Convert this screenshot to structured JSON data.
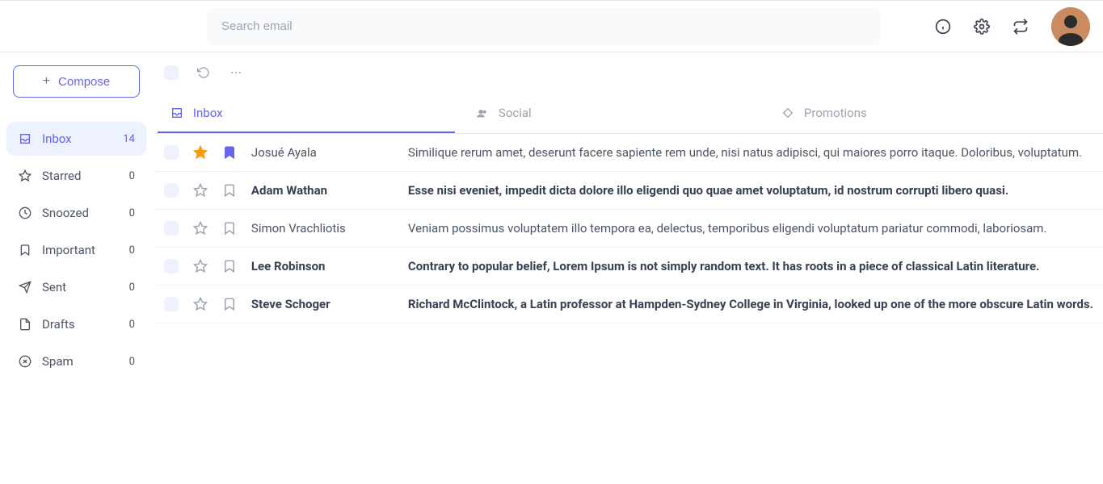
{
  "search": {
    "placeholder": "Search email"
  },
  "compose_label": "Compose",
  "sidebar": {
    "items": [
      {
        "label": "Inbox",
        "count": "14",
        "icon": "inbox",
        "active": true
      },
      {
        "label": "Starred",
        "count": "0",
        "icon": "star"
      },
      {
        "label": "Snoozed",
        "count": "0",
        "icon": "clock"
      },
      {
        "label": "Important",
        "count": "0",
        "icon": "bookmark"
      },
      {
        "label": "Sent",
        "count": "0",
        "icon": "send"
      },
      {
        "label": "Drafts",
        "count": "0",
        "icon": "file"
      },
      {
        "label": "Spam",
        "count": "0",
        "icon": "x-circle"
      }
    ]
  },
  "tabs": [
    {
      "label": "Inbox",
      "active": true
    },
    {
      "label": "Social"
    },
    {
      "label": "Promotions"
    }
  ],
  "emails": [
    {
      "sender": "Josué Ayala",
      "subject": "Similique rerum amet, deserunt facere sapiente rem unde, nisi natus adipisci, qui maiores porro itaque. Doloribus, voluptatum.",
      "unread": false,
      "starred": true,
      "bookmarked": true
    },
    {
      "sender": "Adam Wathan",
      "subject": "Esse nisi eveniet, impedit dicta dolore illo eligendi quo quae amet voluptatum, id nostrum corrupti libero quasi.",
      "unread": true,
      "starred": false,
      "bookmarked": false
    },
    {
      "sender": "Simon Vrachliotis",
      "subject": "Veniam possimus voluptatem illo tempora ea, delectus, temporibus eligendi voluptatum pariatur commodi, laboriosam.",
      "unread": false,
      "starred": false,
      "bookmarked": false
    },
    {
      "sender": "Lee Robinson",
      "subject": "Contrary to popular belief, Lorem Ipsum is not simply random text. It has roots in a piece of classical Latin literature.",
      "unread": true,
      "starred": false,
      "bookmarked": false
    },
    {
      "sender": "Steve Schoger",
      "subject": "Richard McClintock, a Latin professor at Hampden-Sydney College in Virginia, looked up one of the more obscure Latin words.",
      "unread": true,
      "starred": false,
      "bookmarked": false
    }
  ]
}
